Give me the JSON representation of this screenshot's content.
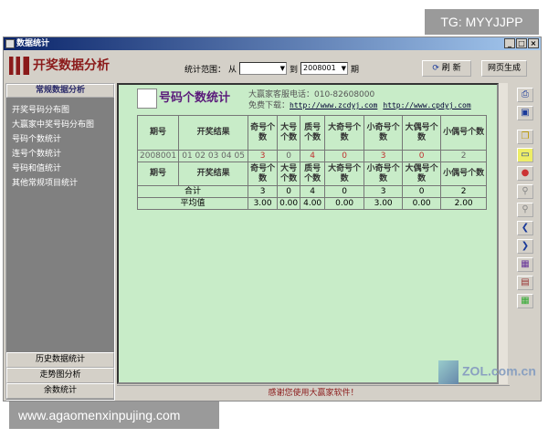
{
  "badge": "TG: MYYJJPP",
  "watermark": "www.agaomenxinpujing.com",
  "zol": "ZOL.com.cn",
  "window": {
    "title": "数据统计",
    "min": "_",
    "max": "□",
    "close": "×"
  },
  "toolbar": {
    "app_title": "开奖数据分析",
    "range_label": "统计范围：",
    "from_label": "从",
    "from_value": "",
    "to_label": "到",
    "to_value": "2008001",
    "period_label": "期",
    "refresh": "刷 新",
    "web": "网页生成"
  },
  "sidebar": {
    "header": "常规数据分析",
    "items": [
      "开奖号码分布图",
      "大赢家中奖号码分布图",
      "号码个数统计",
      "连号个数统计",
      "号码和值统计",
      "其他常规项目统计"
    ],
    "bottom": [
      "历史数据统计",
      "走势图分析",
      "余数统计"
    ]
  },
  "page": {
    "title": "号码个数统计",
    "phone": "大赢家客服电话：010-82608000",
    "download_label": "免费下载：",
    "link1": "http://www.zcdyj.com",
    "link2": "http://www.cpdyj.com"
  },
  "table": {
    "headers": [
      "期号",
      "开奖结果",
      "奇号个数",
      "大号个数",
      "质号个数",
      "大奇号个数",
      "小奇号个数",
      "大偶号个数",
      "小偶号个数"
    ],
    "rows": [
      [
        "2008001",
        "01 02 03 04 05",
        "3",
        "0",
        "4",
        "0",
        "3",
        "0",
        "2"
      ]
    ],
    "total_label": "合计",
    "totals": [
      "3",
      "0",
      "4",
      "0",
      "3",
      "0",
      "2"
    ],
    "avg_label": "平均值",
    "avgs": [
      "3.00",
      "0.00",
      "4.00",
      "0.00",
      "3.00",
      "0.00",
      "2.00"
    ]
  },
  "status": "感谢您使用大赢家软件！",
  "tools": [
    "print-icon",
    "save-icon",
    "copy-icon",
    "note-icon",
    "paint-icon",
    "zoom-in-icon",
    "zoom-out-icon",
    "prev-icon",
    "next-icon",
    "chart-icon",
    "book-icon",
    "table-icon"
  ]
}
